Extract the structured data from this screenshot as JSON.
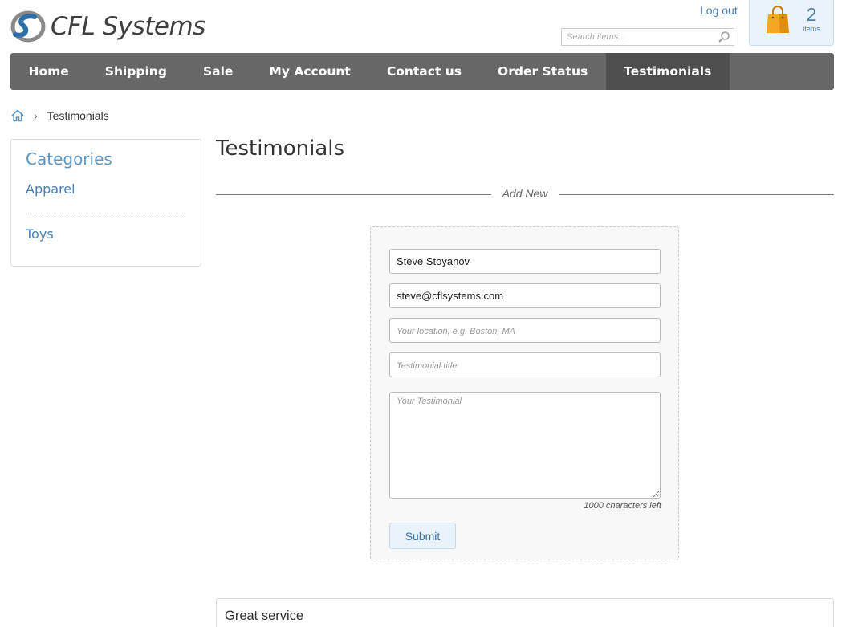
{
  "header": {
    "logo_text": "CFL Systems",
    "logout_label": "Log out",
    "search_placeholder": "Search items...",
    "cart": {
      "count": "2",
      "items_label": "items"
    }
  },
  "nav": {
    "items": [
      {
        "label": "Home"
      },
      {
        "label": "Shipping"
      },
      {
        "label": "Sale"
      },
      {
        "label": "My Account"
      },
      {
        "label": "Contact us"
      },
      {
        "label": "Order Status"
      },
      {
        "label": "Testimonials",
        "active": true
      }
    ]
  },
  "breadcrumb": {
    "separator": "›",
    "current": "Testimonials"
  },
  "sidebar": {
    "title": "Categories",
    "items": [
      {
        "label": "Apparel"
      },
      {
        "label": "Toys"
      }
    ]
  },
  "main": {
    "title": "Testimonials",
    "divider_label": "Add New",
    "form": {
      "name_value": "Steve Stoyanov",
      "email_value": "steve@cflsystems.com",
      "location_placeholder": "Your location, e.g. Boston, MA",
      "title_placeholder": "Testimonial title",
      "testimonial_placeholder": "Your Testimonial",
      "chars_left": "1000 characters left",
      "submit_label": "Submit"
    },
    "testimonials": [
      {
        "title": "Great service"
      }
    ]
  },
  "colors": {
    "nav_bg": "#676767",
    "nav_active_bg": "#4e4e4e",
    "link": "#4a7fb0",
    "cart_bg": "#eaf2fa",
    "bag": "#f5a623"
  }
}
